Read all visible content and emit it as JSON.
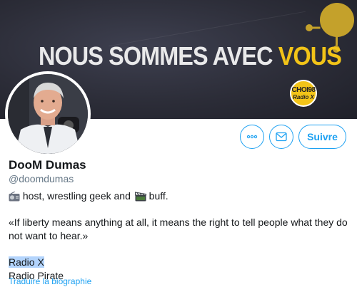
{
  "banner": {
    "headline_part1": "NOUS SOMMES AVEC",
    "headline_part2": "VOUS",
    "logo_line1": "CHOI98",
    "logo_line2": "Radio X",
    "accent_color": "#f2c418"
  },
  "actions": {
    "more_icon": "more-horizontal-icon",
    "message_icon": "envelope-icon",
    "follow_label": "Suivre",
    "accent_color": "#1da1f2"
  },
  "profile": {
    "display_name": "DooM Dumas",
    "handle": "@doomdumas",
    "bio": {
      "line1_part1": " host, wrestling geek and ",
      "line1_part2": " buff.",
      "emoji1": "radio-icon",
      "emoji2": "clapperboard-icon",
      "quote_line1": "«If liberty means anything at all, it means the right to tell people what they do",
      "quote_line2": "not want to hear.»",
      "line3": "Radio X",
      "line4": "Radio Pirate"
    },
    "translate_link": "Traduire la biographie"
  }
}
